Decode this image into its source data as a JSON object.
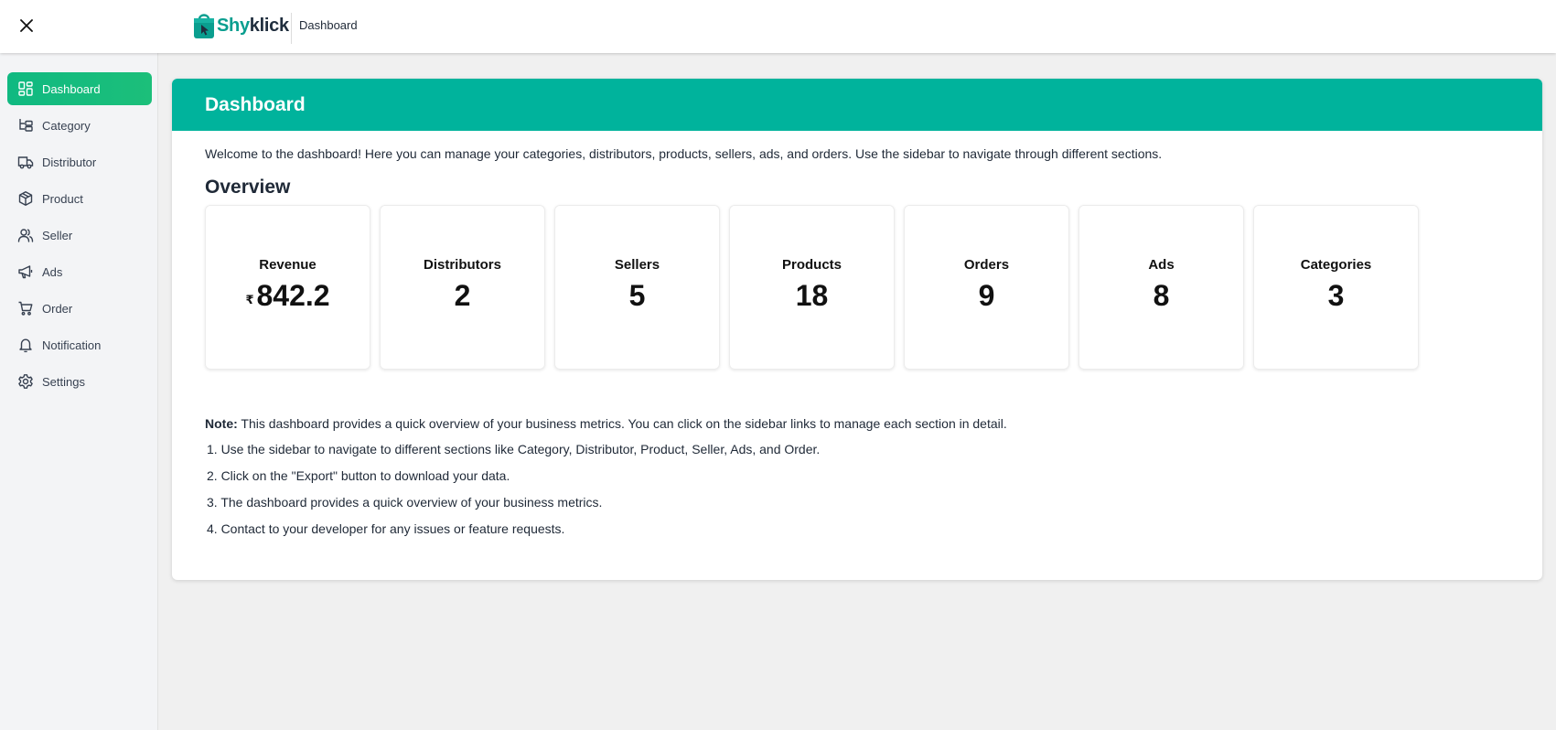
{
  "header": {
    "brand_part1": "Shy",
    "brand_part2": "klick",
    "breadcrumb": "Dashboard"
  },
  "sidebar": {
    "items": [
      {
        "label": "Dashboard",
        "icon": "dashboard-grid-icon",
        "active": true
      },
      {
        "label": "Category",
        "icon": "category-tree-icon",
        "active": false
      },
      {
        "label": "Distributor",
        "icon": "truck-icon",
        "active": false
      },
      {
        "label": "Product",
        "icon": "box-icon",
        "active": false
      },
      {
        "label": "Seller",
        "icon": "users-icon",
        "active": false
      },
      {
        "label": "Ads",
        "icon": "megaphone-icon",
        "active": false
      },
      {
        "label": "Order",
        "icon": "cart-icon",
        "active": false
      },
      {
        "label": "Notification",
        "icon": "bell-icon",
        "active": false
      },
      {
        "label": "Settings",
        "icon": "gear-icon",
        "active": false
      }
    ]
  },
  "main": {
    "title": "Dashboard",
    "welcome": "Welcome to the dashboard! Here you can manage your categories, distributors, products, sellers, ads, and orders. Use the sidebar to navigate through different sections.",
    "overview_title": "Overview",
    "stats": [
      {
        "label": "Revenue",
        "value": "842.2",
        "currency": "₹"
      },
      {
        "label": "Distributors",
        "value": "2"
      },
      {
        "label": "Sellers",
        "value": "5"
      },
      {
        "label": "Products",
        "value": "18"
      },
      {
        "label": "Orders",
        "value": "9"
      },
      {
        "label": "Ads",
        "value": "8"
      },
      {
        "label": "Categories",
        "value": "3"
      }
    ],
    "note_label": "Note:",
    "note_text": " This dashboard provides a quick overview of your business metrics. You can click on the sidebar links to manage each section in detail.",
    "steps": [
      "1. Use the sidebar to navigate to different sections like Category, Distributor, Product, Seller, Ads, and Order.",
      "2. Click on the \"Export\" button to download your data.",
      "3. The dashboard provides a quick overview of your business metrics.",
      "4. Contact to your developer for any issues or feature requests."
    ]
  },
  "colors": {
    "accent": "#00b39c",
    "active_nav": "#10b981",
    "brand_primary": "#0a9e8f",
    "brand_dark": "#1f2d3d"
  }
}
